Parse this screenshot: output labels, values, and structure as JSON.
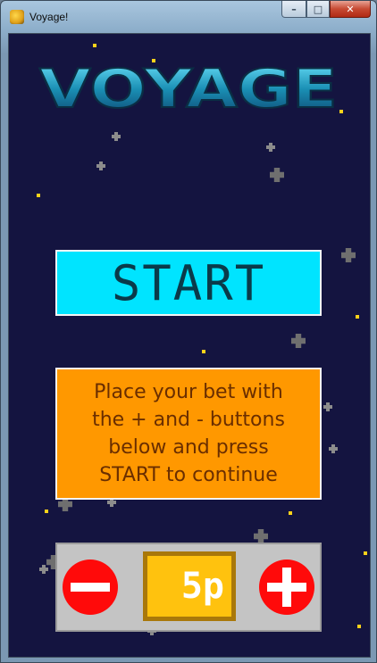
{
  "window": {
    "title": "Voyage!",
    "minimize_glyph": "–",
    "maximize_glyph": "□",
    "close_glyph": "✕"
  },
  "game": {
    "logo_text": "VOYAGE",
    "start_label": "START",
    "instructions": "Place your bet with\nthe + and - buttons\nbelow and press\nSTART to continue",
    "bet": {
      "amount": "5p",
      "decrease_icon": "minus-icon",
      "increase_icon": "plus-icon"
    }
  },
  "colors": {
    "background": "#141440",
    "start_button": "#00e4ff",
    "instructions_box": "#ff9800",
    "bet_panel": "#c4c4c4",
    "bet_buttons": "#ff0a0a",
    "bet_amount_box": "#ffc20e",
    "star": "#ffd21a"
  }
}
